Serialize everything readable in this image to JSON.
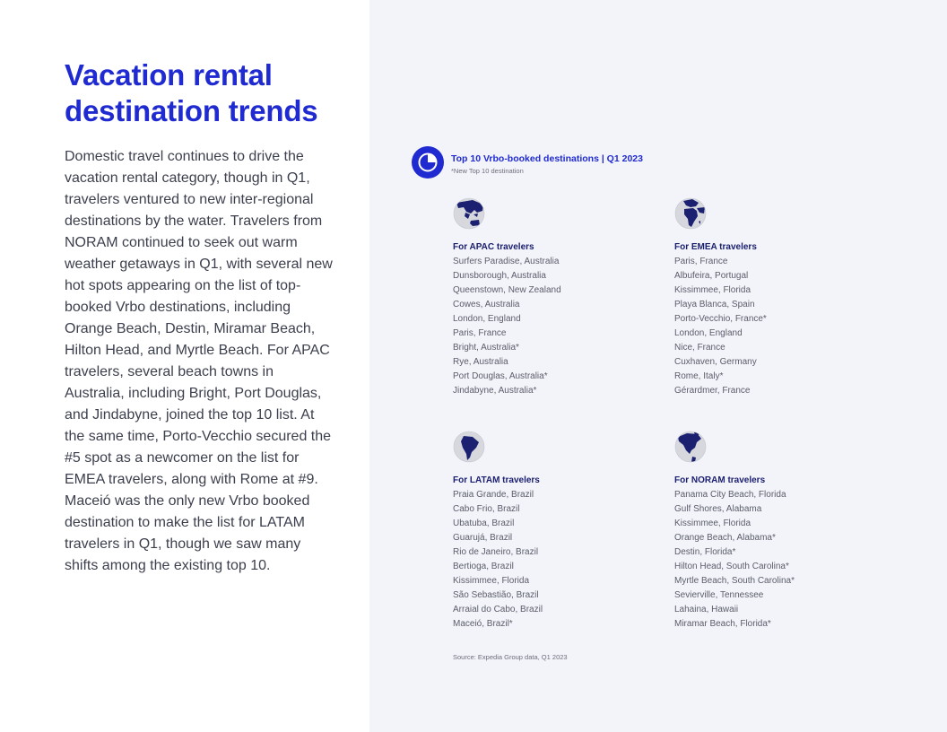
{
  "page": {
    "title": "Vacation rental destination trends",
    "body": "Domestic travel continues to drive the vacation rental category, though in Q1, travelers ventured to new inter-regional destinations by the water. Travelers from NORAM continued to seek out warm weather getaways in Q1, with several new hot spots appearing on the list of top-booked Vrbo destinations, including Orange Beach, Destin, Miramar Beach, Hilton Head, and Myrtle Beach. For APAC travelers, several beach towns in Australia, including Bright, Port Douglas, and Jindabyne, joined the top 10 list. At the same time, Porto-Vecchio secured the #5 spot as a newcomer on the list for EMEA travelers, along with Rome at #9. Maceió was the only new Vrbo booked destination to make the list for LATAM travelers in Q1, though we saw many shifts among the existing top 10."
  },
  "panel": {
    "icon": "pie-chart-icon",
    "title": "Top 10 Vrbo-booked destinations | Q1 2023",
    "note": "*New Top 10 destination",
    "source": "Source: Expedia Group data, Q1 2023"
  },
  "colors": {
    "accent": "#1f2ad1",
    "panel_bg": "#f3f4f9",
    "region_title": "#1c2070"
  },
  "regions": [
    {
      "icon": "globe-asia-icon",
      "title": "For APAC travelers",
      "destinations": [
        "Surfers Paradise, Australia",
        "Dunsborough, Australia",
        "Queenstown, New Zealand",
        "Cowes, Australia",
        "London, England",
        "Paris, France",
        "Bright, Australia*",
        "Rye, Australia",
        "Port Douglas, Australia*",
        "Jindabyne, Australia*"
      ]
    },
    {
      "icon": "globe-europe-africa-icon",
      "title": "For EMEA travelers",
      "destinations": [
        "Paris, France",
        "Albufeira, Portugal",
        "Kissimmee, Florida",
        "Playa Blanca, Spain",
        "Porto-Vecchio, France*",
        "London, England",
        "Nice, France",
        "Cuxhaven, Germany",
        "Rome, Italy*",
        "Gérardmer, France"
      ]
    },
    {
      "icon": "globe-south-america-icon",
      "title": "For LATAM travelers",
      "destinations": [
        "Praia Grande, Brazil",
        "Cabo Frio, Brazil",
        "Ubatuba, Brazil",
        "Guarujá, Brazil",
        "Rio de Janeiro, Brazil",
        "Bertioga, Brazil",
        "Kissimmee, Florida",
        "São Sebastião, Brazil",
        "Arraial do Cabo, Brazil",
        "Maceió, Brazil*"
      ]
    },
    {
      "icon": "globe-north-america-icon",
      "title": "For NORAM travelers",
      "destinations": [
        "Panama City Beach, Florida",
        "Gulf Shores, Alabama",
        "Kissimmee, Florida",
        "Orange Beach, Alabama*",
        "Destin, Florida*",
        "Hilton Head, South Carolina*",
        "Myrtle Beach, South Carolina*",
        "Sevierville, Tennessee",
        "Lahaina, Hawaii",
        "Miramar Beach, Florida*"
      ]
    }
  ]
}
